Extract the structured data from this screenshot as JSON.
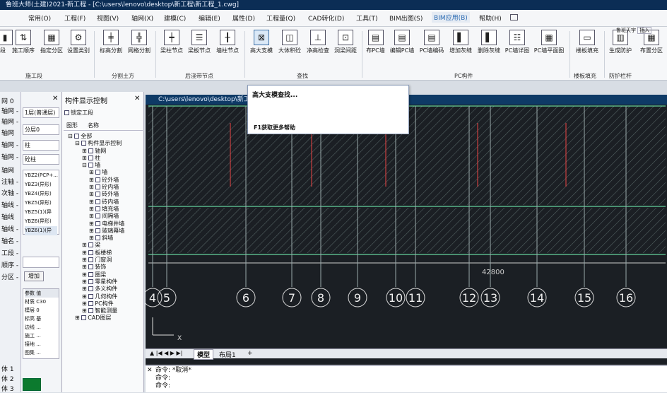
{
  "app_title": "鲁班大师(土建)2021-新工程 - [C:\\users\\lenovo\\desktop\\新工程\\新工程_1.cwg]",
  "menu": [
    "常用(O)",
    "工程(F)",
    "视图(V)",
    "轴网(X)",
    "建模(C)",
    "编辑(E)",
    "属性(D)",
    "工程量(Q)",
    "CAD转化(D)",
    "工具(T)",
    "BIM出图(S)",
    "BIM应用(B)",
    "帮助(H)"
  ],
  "ribbon": {
    "buttons": [
      "段",
      "施工顺序",
      "指定分区",
      "设置类别",
      "标高分割",
      "网格分割",
      "梁柱节点",
      "梁板节点",
      "墙柱节点",
      "高大支模",
      "大体积砼",
      "净高检查",
      "洞梁间距",
      "布PC墙",
      "编辑PC墙",
      "PC墙编码",
      "增加灰缝",
      "删除灰缝",
      "PC墙详图",
      "PC墙平面图",
      "楼板填充",
      "生成防护",
      "布置分区"
    ],
    "groups": [
      "施工段",
      "分割土方",
      "后浇带节点",
      "查找",
      "PC构件",
      "楼板填充",
      "防护栏杆"
    ],
    "style_label": "鲁班天宇",
    "style_value": "插入"
  },
  "left_strip": [
    "网 0",
    "轴网 -",
    "轴网 -",
    "轴网",
    "轴网 -",
    "轴网 -",
    "轴网",
    "注轴 -",
    "次轴 -",
    "轴线 -",
    "轴线",
    "轴线 -",
    "轴名 -",
    "工段 -",
    "顺序 -",
    "分区 -",
    "体 1",
    "体 2",
    "体 3"
  ],
  "panelA": {
    "selects": [
      "1层(普通层)",
      "分层0",
      "柱",
      "砼柱"
    ],
    "list": [
      "YBZ2(PCP+...",
      "YBZ3(异形)",
      "YBZ4(异形)",
      "YBZ5(异形)",
      "YBZ5(1)(异",
      "YBZ6(异形)",
      "YBZ6(1)(异"
    ],
    "add_button": "增加",
    "prop_header": [
      "参数",
      "值"
    ],
    "props": [
      "材质  C30",
      "模层  0",
      "标高  基",
      "边线 ...",
      "施工 ...",
      "接地 ...",
      "图集  ...",
      "图层  ..."
    ]
  },
  "panelB": {
    "title": "构件显示控制",
    "lock_label": "锁定工段",
    "tabs": [
      "图形",
      "名称"
    ],
    "tree": [
      "全部",
      "构件显示控制",
      "轴网",
      "柱",
      "墙",
      "墙",
      "砼外墙",
      "砼内墙",
      "砖外墙",
      "砖内墙",
      "填充墙",
      "间隔墙",
      "电梯井墙",
      "玻璃幕墙",
      "斜墙",
      "梁",
      "板楼梯",
      "门窗洞",
      "装饰",
      "圈梁",
      "零星构件",
      "多义构件",
      "几何构件",
      "PC构件",
      "智能测量",
      "CAD图层"
    ]
  },
  "cad": {
    "title": "C:\\users\\lenovo\\desktop\\新工...",
    "axis_labels": [
      "4",
      "5",
      "6",
      "7",
      "8",
      "9",
      "10",
      "11",
      "12",
      "13",
      "14",
      "15",
      "16"
    ],
    "dimension": "42800",
    "tabs": [
      "模型",
      "布局1",
      "+"
    ],
    "cmd_lines": [
      "命令: *取消*",
      "命令:",
      "命令:"
    ]
  },
  "popup": {
    "title": "高大支模查找...",
    "help": "F1获取更多帮助"
  },
  "colors": {
    "accent": "#2a6ab2",
    "title_bg": "#0b2d55",
    "cad_bg": "#1b1f24"
  }
}
